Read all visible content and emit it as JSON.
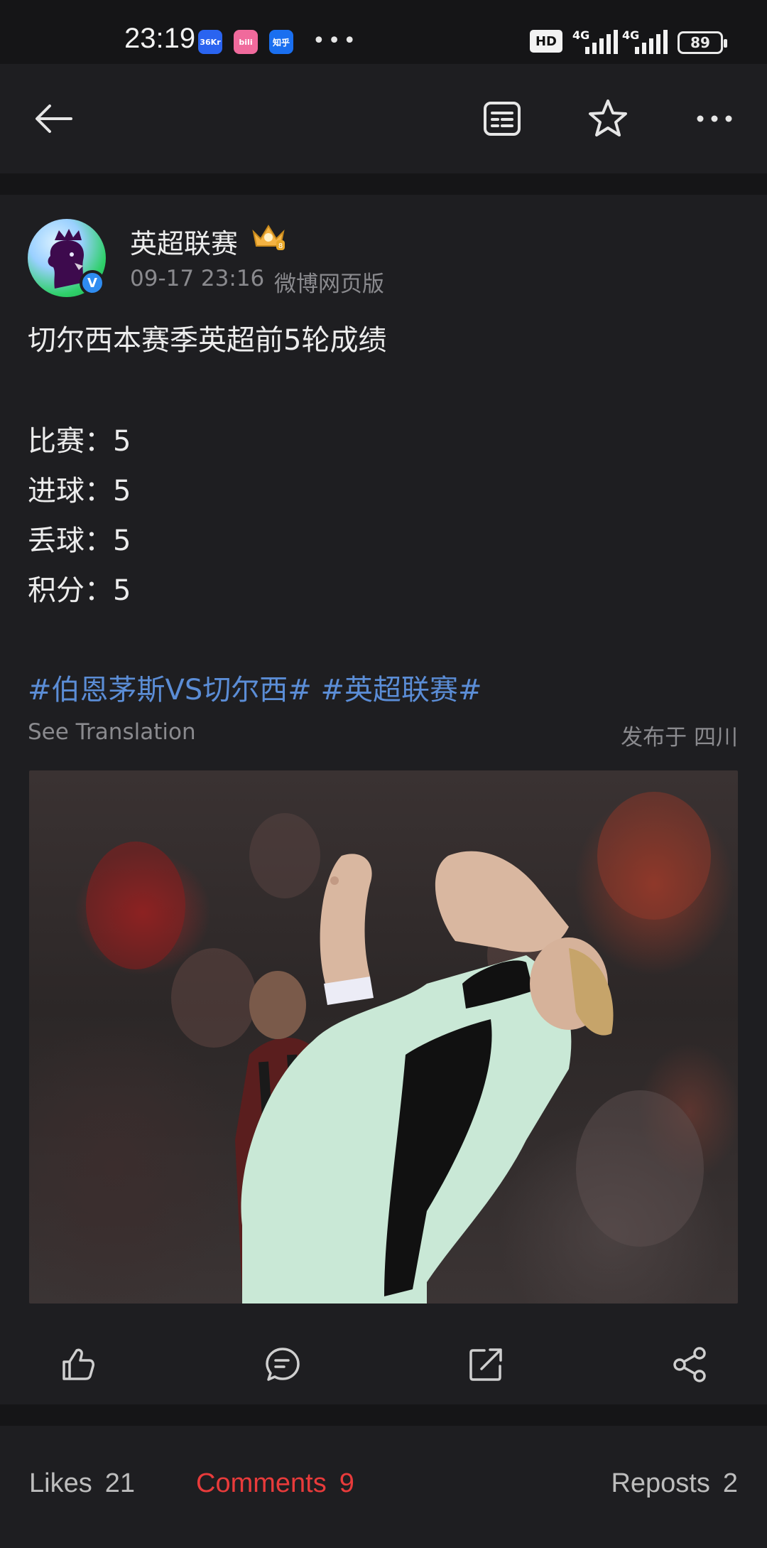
{
  "status_bar": {
    "time": "23:19",
    "app_badges": [
      {
        "label": "36Kr",
        "color": "#2a64f0"
      },
      {
        "label": "bili",
        "color": "#f06a9c"
      },
      {
        "label": "知乎",
        "color": "#1a6ff0"
      }
    ],
    "more": "•••",
    "hd": "HD",
    "network1": "4G",
    "network2": "4G",
    "battery": "89"
  },
  "toolbar": {
    "back_icon": "arrow-left-icon",
    "reader_icon": "article-list-icon",
    "favorite_icon": "star-icon",
    "more_icon": "more-horizontal-icon"
  },
  "post": {
    "author": "英超联赛",
    "time": "09-17 23:16",
    "source": "微博网页版",
    "title_line": "切尔西本赛季英超前5轮成绩",
    "stats": [
      "比赛：5",
      "进球：5",
      "丢球：5",
      "积分：5"
    ],
    "hashtags": "#伯恩茅斯VS切尔西# #英超联赛#",
    "see_translation": "See Translation",
    "published_location": "发布于 四川"
  },
  "actions": {
    "like_icon": "thumb-up-icon",
    "comment_icon": "comment-icon",
    "repost_icon": "repost-icon",
    "share_icon": "share-icon"
  },
  "tabs": {
    "likes_label": "Likes",
    "likes_count": "21",
    "comments_label": "Comments",
    "comments_count": "9",
    "reposts_label": "Reposts",
    "reposts_count": "2",
    "active_color": "#e83b3b"
  }
}
